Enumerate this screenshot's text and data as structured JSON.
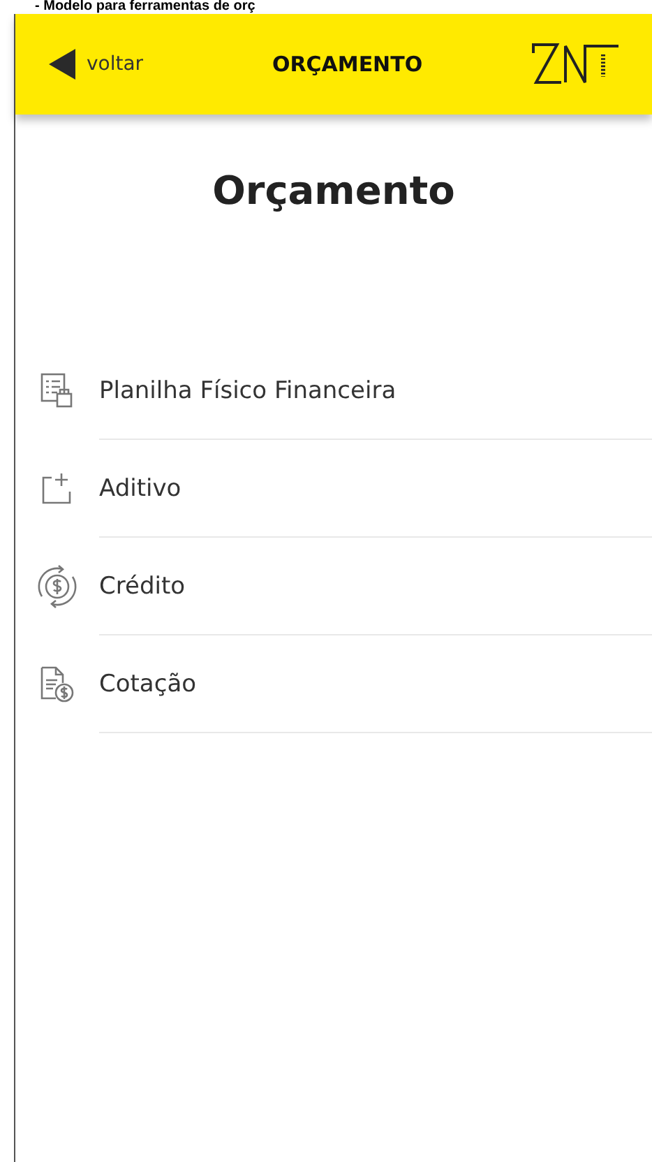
{
  "caption": "- Modelo para ferramentas de orç",
  "header": {
    "back_label": "voltar",
    "title": "ORÇAMENTO"
  },
  "page_title": "Orçamento",
  "menu": [
    {
      "kind": "spreadsheet",
      "label": "Planilha Físico Financeira"
    },
    {
      "kind": "addendum",
      "label": "Aditivo"
    },
    {
      "kind": "credit",
      "label": "Crédito"
    },
    {
      "kind": "quote",
      "label": "Cotação"
    }
  ]
}
